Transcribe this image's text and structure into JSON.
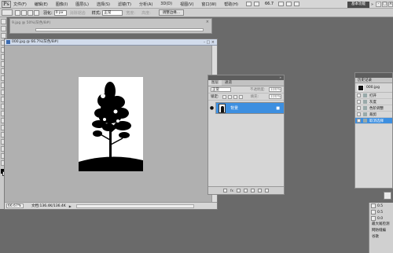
{
  "menubar": {
    "logo": "Ps",
    "items": [
      "文件(F)",
      "编辑(E)",
      "图像(I)",
      "图层(L)",
      "选择(S)",
      "滤镜(T)",
      "分析(A)",
      "3D(D)",
      "视图(V)",
      "窗口(W)",
      "帮助(H)"
    ],
    "zoom": "66.7",
    "workspace": "基本功能"
  },
  "options": {
    "feather_label": "羽化:",
    "feather_value": "0 px",
    "antialias_label": "消除锯齿",
    "style_label": "样式:",
    "style_value": "正常",
    "width_label": "宽度:",
    "height_label": "高度:",
    "refine_button": "调整边缘..."
  },
  "doc_back": {
    "tab": "9.jpg @ 50%(灰色/8#)"
  },
  "document": {
    "title": "000.jpg @ 66.7%(灰色/8#)",
    "zoom": "66.67%",
    "info": "文档:136.4K/136.4K"
  },
  "layers": {
    "tabs": [
      "图层",
      "通道"
    ],
    "blend_mode": "正常",
    "opacity_label": "不透明度:",
    "opacity": "100%",
    "lock_label": "锁定:",
    "fill_label": "填充:",
    "fill": "100%",
    "layer_name": "背景",
    "footer_fx": "fx"
  },
  "history": {
    "tab": "历史记录",
    "snapshot": "000.jpg",
    "steps": [
      "打开",
      "灰度",
      "色阶调整",
      "裁剪",
      "取消选择"
    ],
    "active_step": 4
  },
  "dock": {
    "values": [
      "0.5",
      "0.5",
      "0.0"
    ],
    "text1": "最大尾检测",
    "text2": "网防缝编",
    "text3": "谷歌"
  },
  "colors": {
    "selection": "#3d8fe0",
    "workspace_bg": "#6a6a6a",
    "panel_bg": "#d6d6d6"
  }
}
